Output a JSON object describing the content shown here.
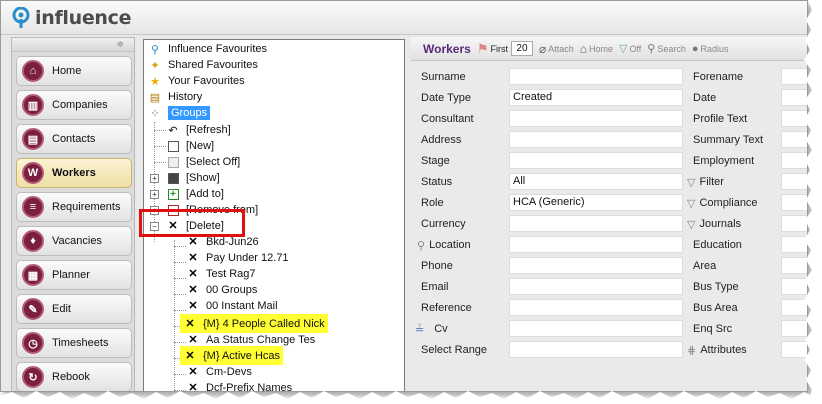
{
  "app": {
    "logo_text": "influence",
    "logo_icon": "influence-logo-icon",
    "brand_color": "#2a8fc9"
  },
  "nav": {
    "grip": "≑",
    "items": [
      {
        "label": "Home",
        "icon": "home-icon"
      },
      {
        "label": "Companies",
        "icon": "companies-icon"
      },
      {
        "label": "Contacts",
        "icon": "contacts-icon"
      },
      {
        "label": "Workers",
        "icon": "workers-icon",
        "active": true
      },
      {
        "label": "Requirements",
        "icon": "requirements-icon"
      },
      {
        "label": "Vacancies",
        "icon": "vacancies-icon"
      },
      {
        "label": "Planner",
        "icon": "planner-icon"
      },
      {
        "label": "Edit",
        "icon": "edit-icon"
      },
      {
        "label": "Timesheets",
        "icon": "timesheets-icon"
      },
      {
        "label": "Rebook",
        "icon": "rebook-icon"
      }
    ]
  },
  "tree": {
    "root": [
      {
        "label": "Influence Favourites",
        "icon": "pin-icon"
      },
      {
        "label": "Shared Favourites",
        "icon": "share-icon"
      },
      {
        "label": "Your Favourites",
        "icon": "star-icon"
      },
      {
        "label": "History",
        "icon": "history-icon"
      },
      {
        "label": "Groups",
        "icon": "groups-icon"
      }
    ],
    "groups": [
      {
        "label": "[Refresh]",
        "icon": "refresh-icon"
      },
      {
        "label": "[New]",
        "icon": "new-icon"
      },
      {
        "label": "[Select Off]",
        "icon": "select-off-icon"
      },
      {
        "label": "[Show]",
        "icon": "show-icon"
      },
      {
        "label": "[Add to]",
        "icon": "add-to-icon"
      },
      {
        "label": "[Remove from]",
        "icon": "remove-from-icon"
      },
      {
        "label": "[Delete]",
        "icon": "delete-icon"
      }
    ],
    "delete_items": [
      {
        "label": "Bkd-Jun26"
      },
      {
        "label": "Pay Under 12.71"
      },
      {
        "label": "Test Rag7"
      },
      {
        "label": "00 Groups"
      },
      {
        "label": "00 Instant Mail"
      },
      {
        "label": "{M} 4 People Called Nick",
        "highlight": true
      },
      {
        "label": "Aa Status Change Tes"
      },
      {
        "label": "{M} Active Hcas",
        "highlight": true
      },
      {
        "label": "Cm-Devs"
      },
      {
        "label": "Dcf-Prefix Names"
      }
    ]
  },
  "toolbar": {
    "title": "Workers",
    "first_label": "First",
    "first_value": "20",
    "attach_label": "Attach",
    "home_label": "Home",
    "off_label": "Off",
    "search_label": "Search",
    "radius_label": "Radius"
  },
  "form": {
    "left": [
      {
        "label": "Surname",
        "value": ""
      },
      {
        "label": "Date Type",
        "value": "Created"
      },
      {
        "label": "Consultant",
        "value": ""
      },
      {
        "label": "Address",
        "value": ""
      },
      {
        "label": "Stage",
        "value": ""
      },
      {
        "label": "Status",
        "value": "All"
      },
      {
        "label": "Role",
        "value": "HCA (Generic)"
      },
      {
        "label": "Currency",
        "value": ""
      },
      {
        "label": "Location",
        "value": "",
        "icon": "location-icon"
      },
      {
        "label": "Phone",
        "value": ""
      },
      {
        "label": "Email",
        "value": ""
      },
      {
        "label": "Reference",
        "value": ""
      },
      {
        "label": "Cv",
        "value": "",
        "icon": "cv-icon"
      },
      {
        "label": "Select Range",
        "value": ""
      }
    ],
    "right": [
      {
        "label": "Forename"
      },
      {
        "label": "Date"
      },
      {
        "label": "Profile Text"
      },
      {
        "label": "Summary Text"
      },
      {
        "label": "Employment"
      },
      {
        "label": "Filter",
        "icon": "filter-icon"
      },
      {
        "label": "Compliance",
        "icon": "filter-icon"
      },
      {
        "label": "Journals",
        "icon": "filter-icon"
      },
      {
        "label": "Education"
      },
      {
        "label": "Area"
      },
      {
        "label": "Bus Type"
      },
      {
        "label": "Bus Area"
      },
      {
        "label": "Enq Src"
      },
      {
        "label": "Attributes",
        "icon": "attributes-icon"
      }
    ]
  },
  "colors": {
    "highlight": "#ffff33",
    "annotation_box": "#e01010",
    "selection": "#3399ff",
    "nav_icon": "#7a1f3e"
  }
}
